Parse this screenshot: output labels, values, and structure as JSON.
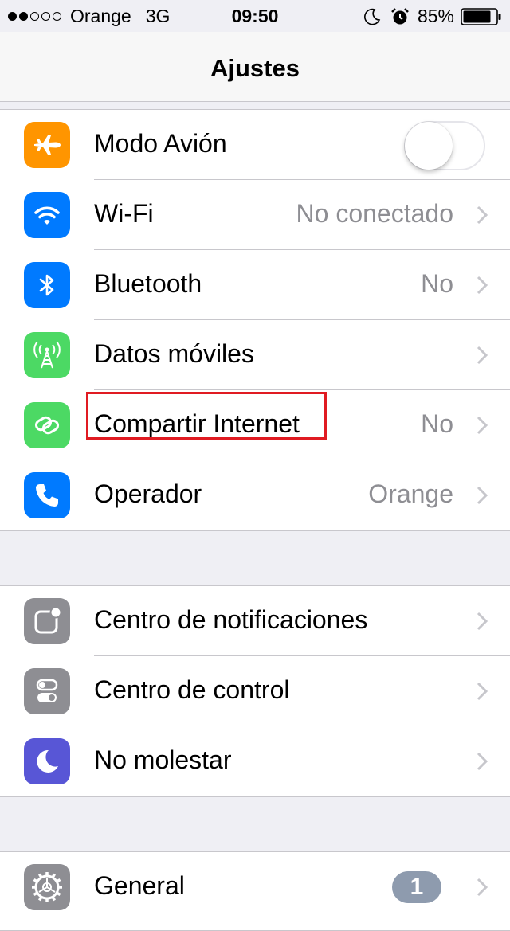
{
  "status_bar": {
    "signal_filled": 2,
    "signal_total": 5,
    "carrier": "Orange",
    "network": "3G",
    "time": "09:50",
    "battery_percent": "85%",
    "battery_level": 0.85
  },
  "nav": {
    "title": "Ajustes"
  },
  "groups": [
    {
      "rows": [
        {
          "id": "airplane",
          "label": "Modo Avión",
          "icon": "airplane-icon",
          "icon_color": "#ff9500",
          "toggle": false
        },
        {
          "id": "wifi",
          "label": "Wi-Fi",
          "value": "No conectado",
          "icon": "wifi-icon",
          "icon_color": "#007aff"
        },
        {
          "id": "bluetooth",
          "label": "Bluetooth",
          "value": "No",
          "icon": "bluetooth-icon",
          "icon_color": "#007aff"
        },
        {
          "id": "cellular",
          "label": "Datos móviles",
          "value": "",
          "icon": "cellular-antenna-icon",
          "icon_color": "#4cd964"
        },
        {
          "id": "hotspot",
          "label": "Compartir Internet",
          "value": "No",
          "icon": "chain-link-icon",
          "icon_color": "#4cd964",
          "highlighted": true
        },
        {
          "id": "carrier",
          "label": "Operador",
          "value": "Orange",
          "icon": "phone-icon",
          "icon_color": "#007aff"
        }
      ]
    },
    {
      "rows": [
        {
          "id": "notifications",
          "label": "Centro de notificaciones",
          "icon": "notification-center-icon",
          "icon_color": "#8e8e93"
        },
        {
          "id": "control",
          "label": "Centro de control",
          "icon": "control-center-icon",
          "icon_color": "#8e8e93"
        },
        {
          "id": "dnd",
          "label": "No molestar",
          "icon": "moon-icon",
          "icon_color": "#5856d6"
        }
      ]
    },
    {
      "rows": [
        {
          "id": "general",
          "label": "General",
          "badge": "1",
          "icon": "gear-icon",
          "icon_color": "#8e8e93"
        }
      ]
    }
  ],
  "colors": {
    "highlight_border": "#e01b22",
    "secondary_text": "#8e8e93",
    "chevron": "#c7c7cc",
    "background": "#efeff4"
  }
}
